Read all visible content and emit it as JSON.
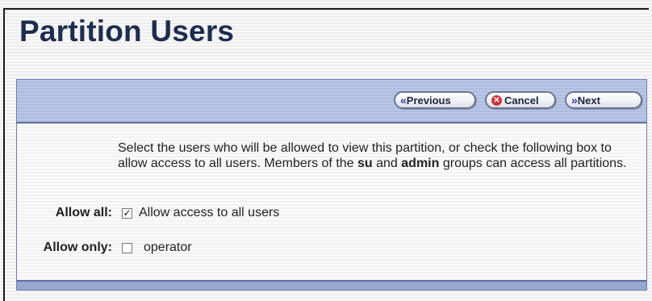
{
  "page": {
    "title": "Partition Users"
  },
  "toolbar": {
    "previous_label": "Previous",
    "cancel_label": "Cancel",
    "next_label": "Next"
  },
  "description": {
    "part1": "Select the users who will be allowed to view this partition, or check the following box to allow access to all users. Members of the ",
    "bold1": "su",
    "part2": " and ",
    "bold2": "admin",
    "part3": " groups can access all partitions."
  },
  "allow_all": {
    "label": "Allow all:",
    "checkbox_label": "Allow access to all users",
    "checked": true
  },
  "allow_only": {
    "label": "Allow only:",
    "users": [
      {
        "name": "operator",
        "checked": false
      }
    ]
  },
  "colors": {
    "title": "#1c2d50",
    "toolbar": "#b4c2e3",
    "accent_border": "#5c6d9e",
    "cancel_icon": "#d0343a"
  }
}
